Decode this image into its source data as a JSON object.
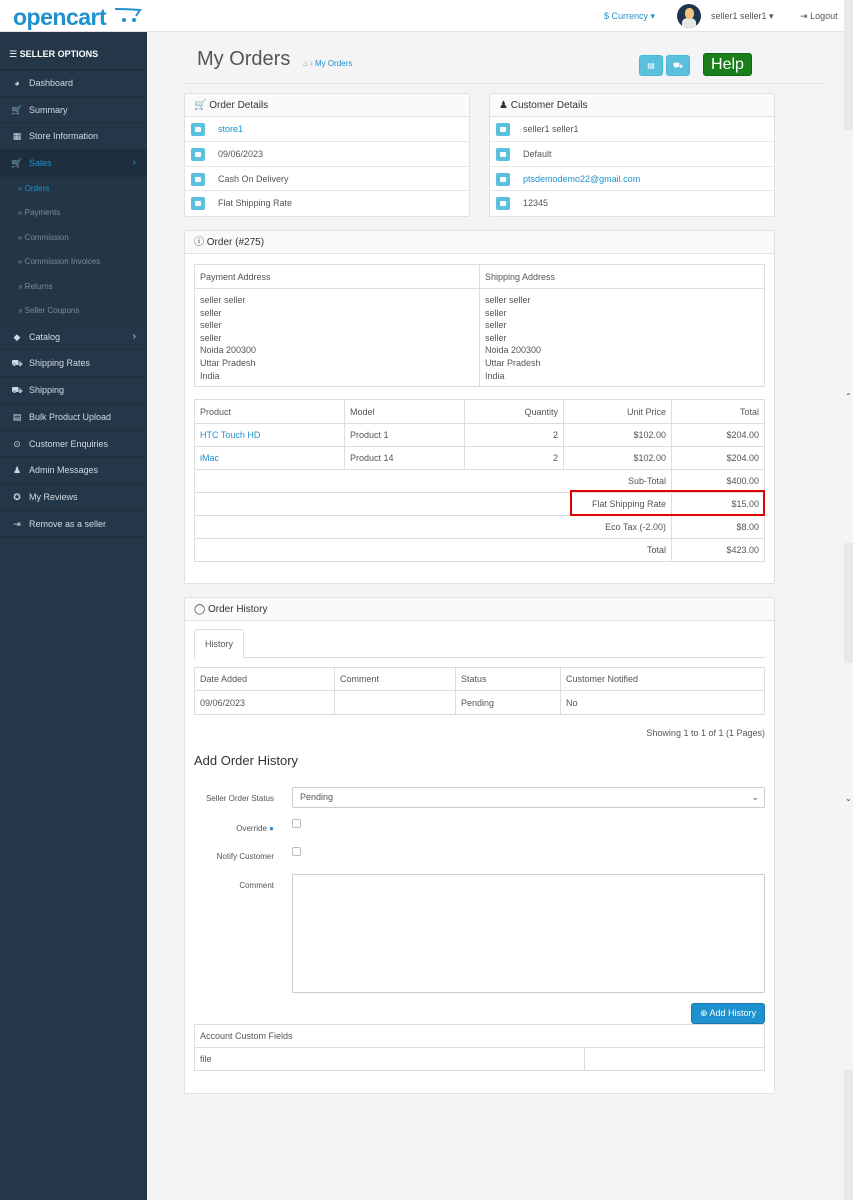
{
  "header": {
    "logo_text": "opencart",
    "currency": "$ Currency ▾",
    "user": "seller1 seller1",
    "logout": "Logout"
  },
  "sidebar": {
    "title": "SELLER OPTIONS",
    "items": [
      {
        "label": "Dashboard",
        "icon": "dashboard-icon"
      },
      {
        "label": "Summary",
        "icon": "cart-icon"
      },
      {
        "label": "Store Information",
        "icon": "store-icon"
      },
      {
        "label": "Sales",
        "icon": "cart-icon",
        "active": true
      },
      {
        "label": "Catalog",
        "icon": "tag-icon"
      },
      {
        "label": "Shipping Rates",
        "icon": "truck-icon"
      },
      {
        "label": "Shipping",
        "icon": "truck-icon"
      },
      {
        "label": "Bulk Product Upload",
        "icon": "file-icon"
      },
      {
        "label": "Customer Enquiries",
        "icon": "question-icon"
      },
      {
        "label": "Admin Messages",
        "icon": "user-plus-icon"
      },
      {
        "label": "My Reviews",
        "icon": "life-ring-icon"
      },
      {
        "label": "Remove as a seller",
        "icon": "sign-out-icon"
      }
    ],
    "sales_sub": [
      "» Orders",
      "» Payments",
      "» Commission",
      "» Commission Invoices",
      "» Returns",
      "» Seller Coupons"
    ]
  },
  "page": {
    "title": "My Orders",
    "breadcrumb": "My Orders",
    "help": "Help"
  },
  "order_details": {
    "title": "Order Details",
    "store": "store1",
    "date": "09/06/2023",
    "payment": "Cash On Delivery",
    "shipping": "Flat Shipping Rate"
  },
  "customer_details": {
    "title": "Customer Details",
    "name": "seller1 seller1",
    "group": "Default",
    "email": "ptsdemodemo22@gmail.com",
    "phone": "12345"
  },
  "order": {
    "title": "Order (#275)",
    "payment_address_label": "Payment Address",
    "shipping_address_label": "Shipping Address",
    "payment_address": [
      "seller seller",
      "seller",
      "seller",
      "seller",
      "Noida 200300",
      "Uttar Pradesh",
      "India"
    ],
    "shipping_address": [
      "seller seller",
      "seller",
      "seller",
      "seller",
      "Noida 200300",
      "Uttar Pradesh",
      "India"
    ],
    "columns": [
      "Product",
      "Model",
      "Quantity",
      "Unit Price",
      "Total"
    ],
    "products": [
      {
        "name": "HTC Touch HD",
        "model": "Product 1",
        "qty": "2",
        "price": "$102.00",
        "total": "$204.00"
      },
      {
        "name": "iMac",
        "model": "Product 14",
        "qty": "2",
        "price": "$102.00",
        "total": "$204.00"
      }
    ],
    "totals": [
      {
        "label": "Sub-Total",
        "value": "$400.00"
      },
      {
        "label": "Flat Shipping Rate",
        "value": "$15.00"
      },
      {
        "label": "Eco Tax (-2.00)",
        "value": "$8.00"
      },
      {
        "label": "Total",
        "value": "$423.00"
      }
    ]
  },
  "history": {
    "title": "Order History",
    "tab": "History",
    "columns": [
      "Date Added",
      "Comment",
      "Status",
      "Customer Notified"
    ],
    "rows": [
      {
        "date": "09/06/2023",
        "comment": "",
        "status": "Pending",
        "notified": "No"
      }
    ],
    "showing": "Showing 1 to 1 of 1 (1 Pages)"
  },
  "add_history": {
    "title": "Add Order History",
    "status_label": "Seller Order Status",
    "status_value": "Pending",
    "override_label": "Override",
    "notify_label": "Notify Customer",
    "comment_label": "Comment",
    "button": "Add History",
    "custom_fields_label": "Account Custom Fields",
    "custom_field_value": "file"
  }
}
